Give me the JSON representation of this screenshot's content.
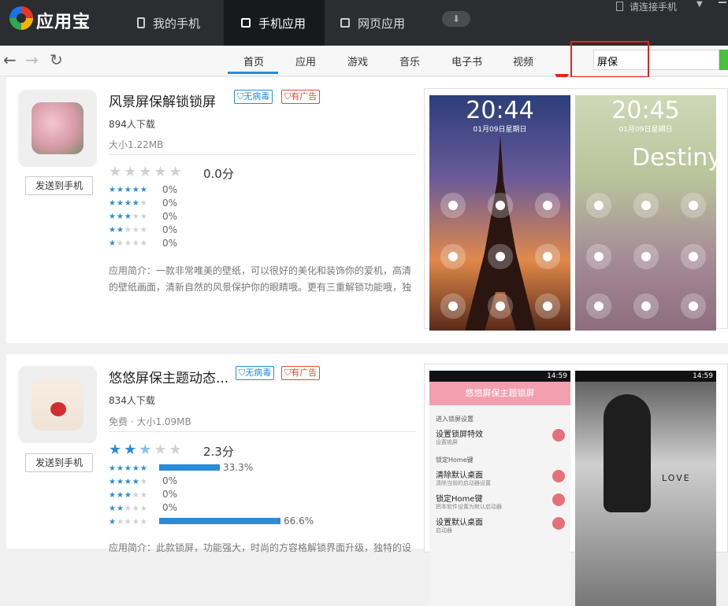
{
  "topbar": {
    "brand": "应用宝",
    "tabs": [
      {
        "label": "我的手机"
      },
      {
        "label": "手机应用"
      },
      {
        "label": "网页应用"
      }
    ],
    "download_icon": "download-icon",
    "connect": "请连接手机"
  },
  "nav": {
    "categories": [
      "首页",
      "应用",
      "游戏",
      "音乐",
      "电子书",
      "视频"
    ],
    "search_value": "屏保"
  },
  "apps": [
    {
      "title": "风景屏保解锁锁屏",
      "badge_safe": "无病毒",
      "badge_ad": "有广告",
      "downloads": "894人下载",
      "size": "大小1.22MB",
      "rating_value": 0,
      "score": "0.0分",
      "dist": [
        {
          "pct": "0%"
        },
        {
          "pct": "0%"
        },
        {
          "pct": "0%"
        },
        {
          "pct": "0%"
        },
        {
          "pct": "0%"
        }
      ],
      "description": "应用简介：一款非常唯美的壁纸，可以很好的美化和装饰你的爱机，高清的壁纸画面，清新自然的风景保护你的眼睛哦。更有三重解锁功能哦，独",
      "send": "发送到手机",
      "shots": [
        {
          "time": "20:44",
          "date": "01月09日星期日"
        },
        {
          "time": "20:45",
          "date": "01月09日星期日",
          "text": "Destiny"
        }
      ]
    },
    {
      "title": "悠悠屏保主题动态...",
      "badge_safe": "无病毒",
      "badge_ad": "有广告",
      "downloads": "834人下载",
      "size": "免费 · 大小1.09MB",
      "rating_value": 2.3,
      "score": "2.3分",
      "dist": [
        {
          "pct": "33.3%",
          "value": 33.3
        },
        {
          "pct": "0%",
          "value": 0
        },
        {
          "pct": "0%",
          "value": 0
        },
        {
          "pct": "0%",
          "value": 0
        },
        {
          "pct": "66.6%",
          "value": 66.6
        }
      ],
      "description": "应用简介：此款锁屏，功能强大，时尚的方容格解锁界面升级，独特的设",
      "send": "发送到手机",
      "shot1": {
        "status_time": "14:59",
        "header": "悠悠屏保主题锁屏",
        "section1": "进入锁屏设置",
        "item1": "设置锁屏特效",
        "item1_sub": "设置锁屏",
        "section2": "锁定Home键",
        "item2": "清除默认桌面",
        "item2_sub": "清除当前的启动器设置",
        "item3": "锁定Home键",
        "item3_sub": "把本软件设置为默认启动器",
        "item4": "设置默认桌面",
        "item4_sub": "启动器"
      },
      "shot2": {
        "status_time": "14:59",
        "text": "LOVE"
      }
    }
  ],
  "colors": {
    "accent": "#2a8bd8",
    "topbar": "#2b2d30",
    "highlight": "#e5231a"
  }
}
